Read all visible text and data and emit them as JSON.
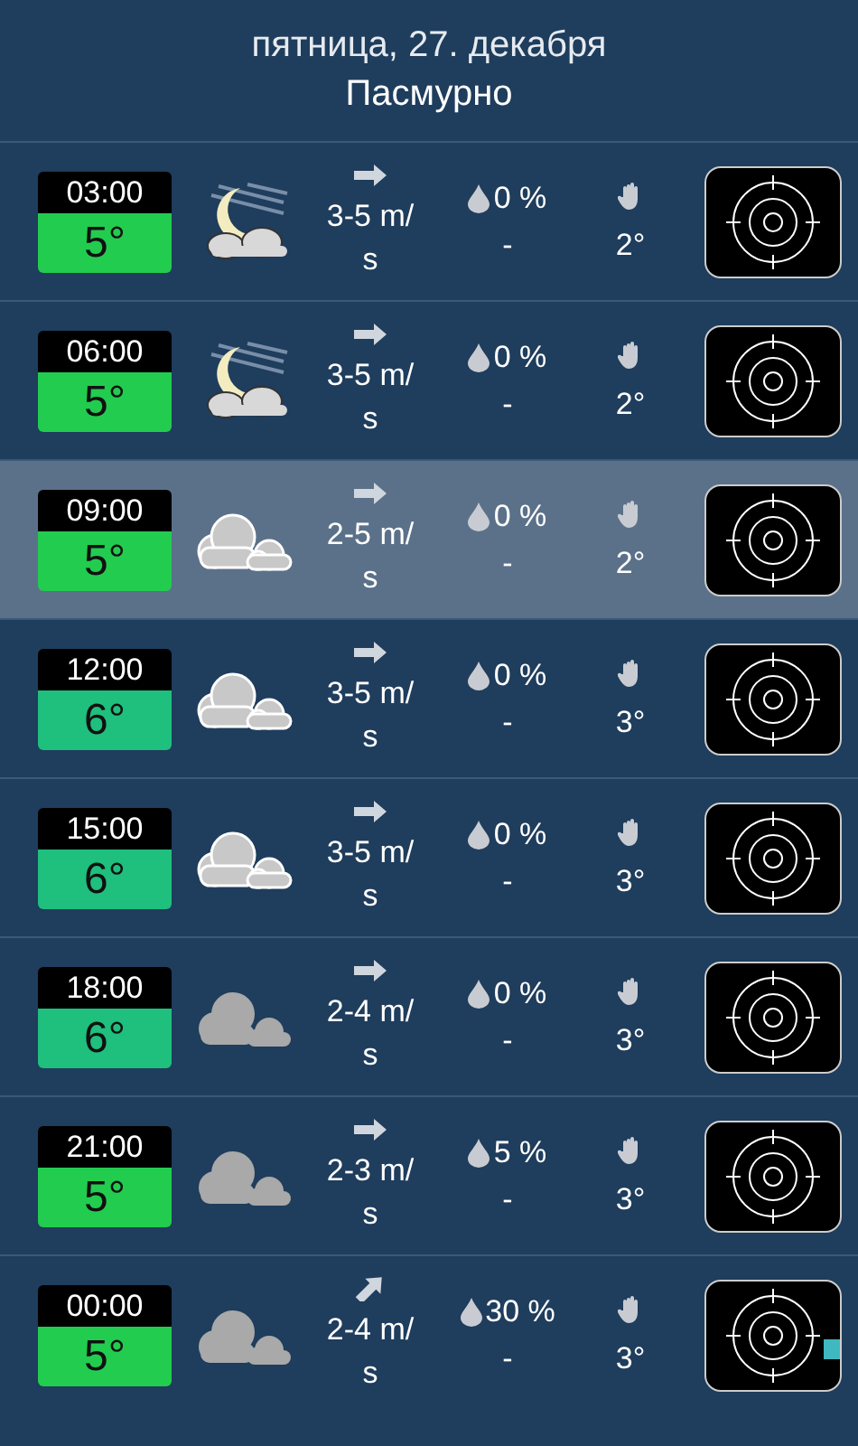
{
  "header": {
    "date": "пятница, 27. декабря",
    "condition": "Пасмурно"
  },
  "rows": [
    {
      "kind": "night",
      "time": "03:00",
      "temp": "5°",
      "color": "#22cc4f",
      "wind": {
        "kind": "straight",
        "speed": "3-5 m/s"
      },
      "precip": "0 %",
      "precip_amount": "-",
      "feels": "2°",
      "selected": false,
      "radar_blip": false
    },
    {
      "kind": "night",
      "time": "06:00",
      "temp": "5°",
      "color": "#22cc4f",
      "wind": {
        "kind": "straight",
        "speed": "3-5 m/s"
      },
      "precip": "0 %",
      "precip_amount": "-",
      "feels": "2°",
      "selected": false,
      "radar_blip": false
    },
    {
      "kind": "cloudy",
      "time": "09:00",
      "temp": "5°",
      "color": "#22cc4f",
      "wind": {
        "kind": "straight",
        "speed": "2-5 m/s"
      },
      "precip": "0 %",
      "precip_amount": "-",
      "feels": "2°",
      "selected": true,
      "radar_blip": false
    },
    {
      "kind": "cloudy",
      "time": "12:00",
      "temp": "6°",
      "color": "#1fbf7d",
      "wind": {
        "kind": "straight",
        "speed": "3-5 m/s"
      },
      "precip": "0 %",
      "precip_amount": "-",
      "feels": "3°",
      "selected": false,
      "radar_blip": false
    },
    {
      "kind": "cloudy",
      "time": "15:00",
      "temp": "6°",
      "color": "#1fbf7d",
      "wind": {
        "kind": "straight",
        "speed": "3-5 m/s"
      },
      "precip": "0 %",
      "precip_amount": "-",
      "feels": "3°",
      "selected": false,
      "radar_blip": false
    },
    {
      "kind": "overcast",
      "time": "18:00",
      "temp": "6°",
      "color": "#1fbf7d",
      "wind": {
        "kind": "straight",
        "speed": "2-4 m/s"
      },
      "precip": "0 %",
      "precip_amount": "-",
      "feels": "3°",
      "selected": false,
      "radar_blip": false
    },
    {
      "kind": "overcast",
      "time": "21:00",
      "temp": "5°",
      "color": "#22cc4f",
      "wind": {
        "kind": "straight",
        "speed": "2-3 m/s"
      },
      "precip": "5 %",
      "precip_amount": "-",
      "feels": "3°",
      "selected": false,
      "radar_blip": false
    },
    {
      "kind": "overcast",
      "time": "00:00",
      "temp": "5°",
      "color": "#22cc4f",
      "wind": {
        "kind": "diagonal",
        "speed": "2-4 m/s"
      },
      "precip": "30 %",
      "precip_amount": "-",
      "feels": "3°",
      "selected": false,
      "radar_blip": true
    }
  ]
}
